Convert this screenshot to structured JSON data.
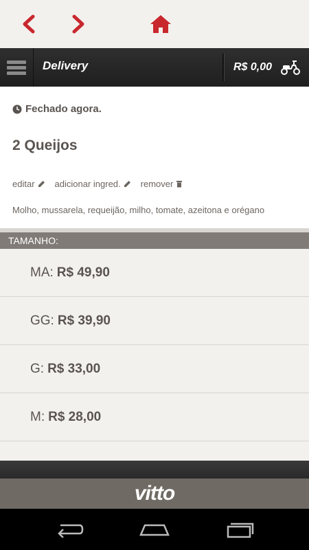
{
  "nav": {
    "back_icon": "chevron-left-icon",
    "forward_icon": "chevron-right-icon",
    "home_icon": "home-icon",
    "accent_color": "#c8282d"
  },
  "header": {
    "title": "Delivery",
    "cart_total": "R$ 0,00",
    "menu_icon": "hamburger-menu-icon",
    "cart_icon": "scooter-icon"
  },
  "store": {
    "status": "Fechado agora."
  },
  "product": {
    "name": "2 Queijos",
    "actions": [
      "editar",
      "adicionar ingred.",
      "remover"
    ],
    "ingredients": "Molho, mussarela, requeijão, milho, tomate, azeitona e orégano"
  },
  "size_section": {
    "title": "TAMANHO:",
    "options": [
      {
        "label": "MA:",
        "price": "R$ 49,90"
      },
      {
        "label": "GG:",
        "price": "R$ 39,90"
      },
      {
        "label": "G:",
        "price": "R$ 33,00"
      },
      {
        "label": "M:",
        "price": "R$ 28,00"
      }
    ]
  },
  "footer": {
    "brand": "vitto"
  }
}
